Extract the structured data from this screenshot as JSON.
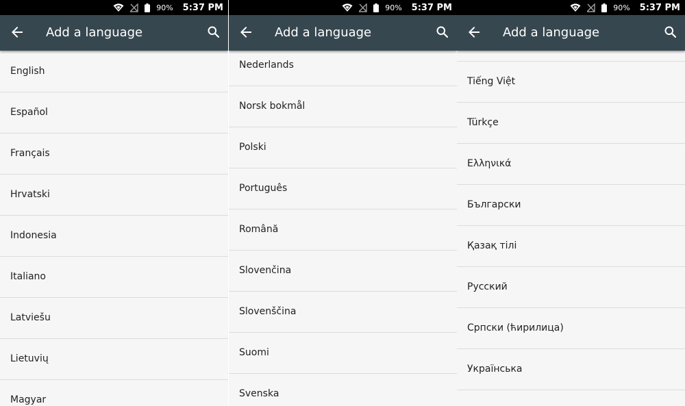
{
  "status_bar": {
    "battery": "90%",
    "time": "5:37 PM"
  },
  "app_bar": {
    "title": "Add a language",
    "back_icon": "arrow-back-icon",
    "search_icon": "search-icon"
  },
  "colors": {
    "app_bar": "#37474f",
    "status_bar": "#000000",
    "list_background": "#f6f6f6",
    "divider": "#dcdcdc"
  },
  "screens": [
    {
      "items": [
        "English",
        "Español",
        "Français",
        "Hrvatski",
        "Indonesia",
        "Italiano",
        "Latviešu",
        "Lietuvių",
        "Magyar"
      ]
    },
    {
      "items": [
        "Nederlands",
        "Norsk bokmål",
        "Polski",
        "Português",
        "Română",
        "Slovenčina",
        "Slovenščina",
        "Suomi",
        "Svenska"
      ]
    },
    {
      "items": [
        "",
        "Tiếng Việt",
        "Türkçe",
        "Ελληνικά",
        "Български",
        "Қазақ тілі",
        "Русский",
        "Српски (ћирилица)",
        "Українська"
      ]
    }
  ]
}
